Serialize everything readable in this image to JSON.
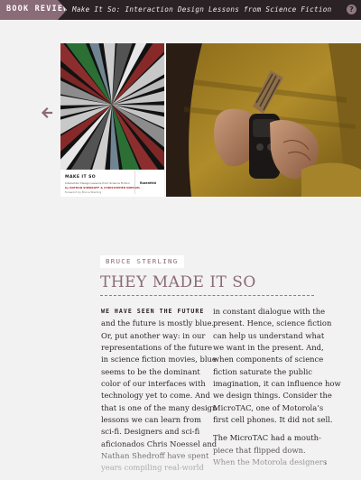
{
  "topbar": {
    "section_label": "BOOK REVIEW",
    "article_title": "Make It So: Interaction Design Lessons from Science Fiction",
    "help_label": "?"
  },
  "carousel": {
    "prev_icon": "arrow-left-icon",
    "book_cover": {
      "title": "MAKE IT SO",
      "subtitle": "Interaction Design Lessons from Science Fiction",
      "authors": "by NATHAN SHEDROFF & CHRISTOPHER NOESSEL",
      "foreword": "foreword by Bruce Sterling",
      "publisher": "Rosenfeld"
    }
  },
  "article": {
    "byline": "BRUCE STERLING",
    "headline": "THEY MADE IT SO",
    "col1": {
      "lead": "WE HAVE SEEN THE FUTURE",
      "lines": [
        "and the future is mostly blue.",
        "Or, put another way: in our",
        "representations of the future",
        "in science fiction movies, blue",
        "seems to be the dominant",
        "color of our interfaces with",
        "technology yet to come. And",
        "that is one of the many design",
        "lessons we can learn from",
        "sci-fi. Designers and sci-fi",
        "aficionados Chris Noessel and",
        "Nathan Shedroff have spent",
        "years compiling real-world"
      ]
    },
    "col2": {
      "lines": [
        "in constant dialogue with the",
        "present. Hence, science fiction",
        "can help us understand what",
        "we want in the present. And,",
        "when components of science",
        "fiction saturate the public",
        "imagination, it can influence how",
        "we design things. Consider the",
        "MicroTAC, one of Motorola’s",
        "first cell phones. It did not sell."
      ],
      "lines2": [
        "The MicroTAC had a mouth-",
        "piece that flipped down.",
        "When the Motorola designers"
      ]
    }
  },
  "colors": {
    "accent": "#8a6b78",
    "topbar_bg": "#2b2226",
    "page_bg": "#f3f2f2"
  }
}
